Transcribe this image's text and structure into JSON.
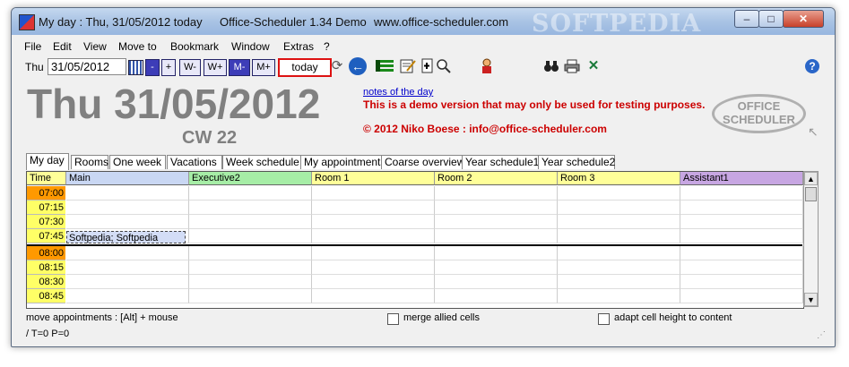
{
  "window": {
    "title_left": "My day : Thu, 31/05/2012 today",
    "title_app": "Office-Scheduler 1.34 Demo",
    "title_url": "www.office-scheduler.com",
    "watermark": "SOFTPEDIA",
    "controls": {
      "minimize": "–",
      "maximize": "□",
      "close": "✕"
    }
  },
  "menu": [
    "File",
    "Edit",
    "View",
    "Move to",
    "Bookmark",
    "Window",
    "Extras",
    "?"
  ],
  "toolbar": {
    "day_label": "Thu",
    "date_value": "31/05/2012",
    "nav_buttons": [
      "-",
      "+",
      "W-",
      "W+",
      "M-",
      "M+"
    ],
    "today_label": "today",
    "help_label": "?"
  },
  "header": {
    "date_title": "Thu 31/05/2012",
    "calendar_week": "CW 22",
    "notes_link": "notes of the day",
    "demo_notice": "This is a demo version that may only be used for testing purposes.",
    "copyright": "© 2012 Niko Boese : info@office-scheduler.com",
    "logo_line1": "OFFICE",
    "logo_line2": "SCHEDULER"
  },
  "tabs": [
    "My day",
    "Rooms",
    "One week",
    "Vacations",
    "Week schedule",
    "My appointments",
    "Coarse overview",
    "Year schedule1",
    "Year schedule2"
  ],
  "grid": {
    "time_header": "Time",
    "columns": [
      {
        "name": "Main",
        "color": "#c9d7f3"
      },
      {
        "name": "Executive2",
        "color": "#a6eda6"
      },
      {
        "name": "Room 1",
        "color": "#ffff99"
      },
      {
        "name": "Room 2",
        "color": "#ffff99"
      },
      {
        "name": "Room 3",
        "color": "#ffff99"
      },
      {
        "name": "Assistant1",
        "color": "#c7a6e2"
      }
    ],
    "times": [
      "07:00",
      "07:15",
      "07:30",
      "07:45",
      "08:00",
      "08:15",
      "08:30",
      "08:45"
    ],
    "appointment": "Softpedia; Softpedia"
  },
  "bottom": {
    "hint": "move appointments : [Alt] + mouse",
    "merge_label": "merge allied cells",
    "adapt_label": "adapt cell height to content",
    "status": "/ T=0  P=0"
  },
  "colors": {
    "hour_orange": "#ff9900",
    "quarter_yellow": "#ffff66",
    "accent_red": "#cc0000"
  }
}
